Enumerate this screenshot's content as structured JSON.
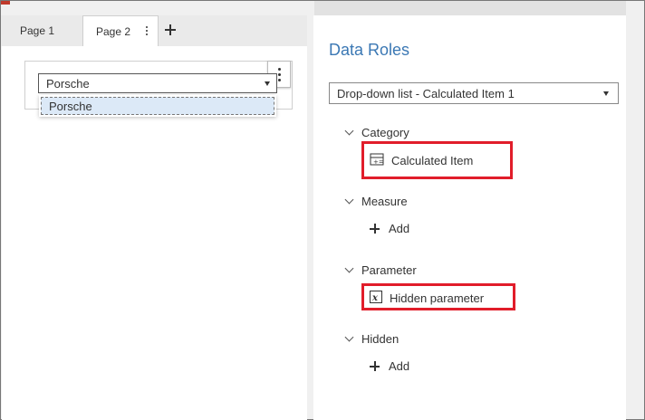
{
  "tabs": [
    {
      "label": "Page 1"
    },
    {
      "label": "Page 2"
    }
  ],
  "canvas": {
    "dropdown_value": "Porsche",
    "dropdown_options": [
      "Porsche"
    ]
  },
  "panel": {
    "title": "Data Roles",
    "object_selector": "Drop-down list - Calculated Item 1",
    "roles": {
      "category": {
        "heading": "Category",
        "item": "Calculated Item"
      },
      "measure": {
        "heading": "Measure",
        "add_label": "Add"
      },
      "parameter": {
        "heading": "Parameter",
        "item": "Hidden parameter"
      },
      "hidden": {
        "heading": "Hidden",
        "add_label": "Add"
      }
    }
  },
  "colors": {
    "accent_blue": "#3b78b4",
    "highlight_red": "#e11d2a",
    "selection_blue": "#dce9f7"
  }
}
